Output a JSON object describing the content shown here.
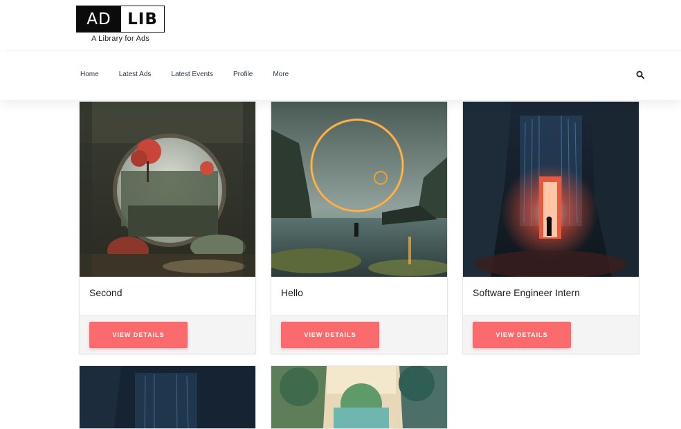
{
  "brand": {
    "ad": "AD",
    "lib": "LIB",
    "tagline": "A Library for Ads"
  },
  "nav": {
    "items": [
      {
        "label": "Home"
      },
      {
        "label": "Latest Ads"
      },
      {
        "label": "Latest Events"
      },
      {
        "label": "Profile"
      },
      {
        "label": "More"
      }
    ],
    "search_icon": "search-icon"
  },
  "cards": [
    {
      "title": "Second",
      "button": "VIEW DETAILS",
      "image": "stone-arch-portal-forest"
    },
    {
      "title": "Hello",
      "button": "VIEW DETAILS",
      "image": "fiery-ring-over-lake"
    },
    {
      "title": "Software Engineer Intern",
      "button": "VIEW DETAILS",
      "image": "glowing-red-doorway-cave"
    }
  ],
  "more_cards": [
    {
      "image": "blue-waterfall-cave"
    },
    {
      "image": "colorful-forest-canyon"
    }
  ],
  "colors": {
    "accent": "#fb6a6c",
    "nav_text": "#2b3a4a"
  }
}
